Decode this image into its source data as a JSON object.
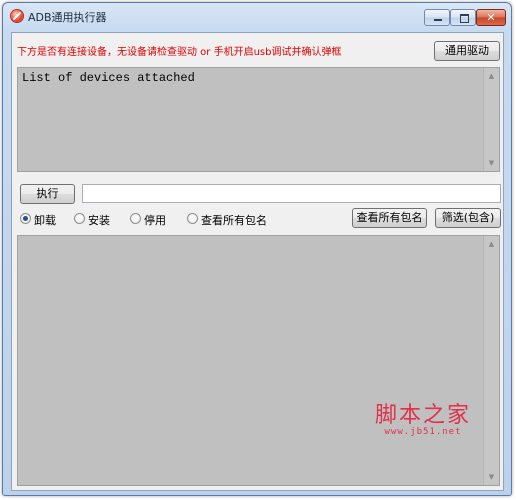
{
  "window": {
    "title": "ADB通用执行器",
    "controls": {
      "minimize": "",
      "maximize": "",
      "close": "✕"
    }
  },
  "header": {
    "hint": "下方是否有连接设备，无设备请检查驱动 or 手机开启usb调试并确认弹框",
    "driver_button": "通用驱动"
  },
  "output_top": {
    "text": "List of devices attached",
    "scroll_up": "▲",
    "scroll_down": "▼"
  },
  "command": {
    "exec_button": "执行",
    "input_value": ""
  },
  "modes": {
    "selected": "uninstall",
    "options": [
      {
        "key": "uninstall",
        "label": "卸载"
      },
      {
        "key": "install",
        "label": "安装"
      },
      {
        "key": "disable",
        "label": "停用"
      },
      {
        "key": "view_all",
        "label": "查看所有包名"
      }
    ]
  },
  "actions": {
    "view_all_button": "查看所有包名",
    "filter_button": "筛选(包含)"
  },
  "output_bottom": {
    "text": "",
    "scroll_up": "▲",
    "scroll_down": "▼"
  },
  "watermark": {
    "main": "脚本之家",
    "sub": "www.jb51.net"
  },
  "colors": {
    "hint_text": "#e00000",
    "textarea_bg": "#c0c0c0",
    "watermark": "#e0304a"
  }
}
